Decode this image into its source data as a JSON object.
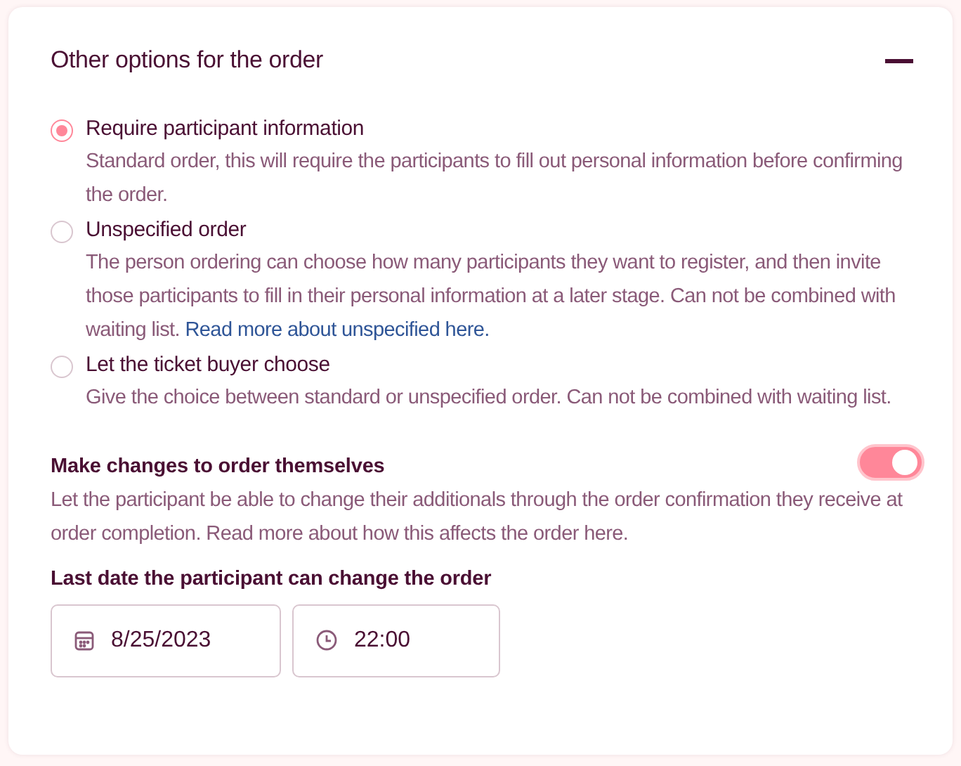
{
  "section": {
    "title": "Other options for the order",
    "expanded": true
  },
  "options": [
    {
      "label": "Require participant information",
      "description": "Standard order, this will require the participants to fill out personal information before confirming the order.",
      "selected": true
    },
    {
      "label": "Unspecified order",
      "description": "The person ordering can choose how many participants they want to register, and then invite those participants to fill in their personal information at a later stage. Can not be combined with waiting list.",
      "link": "Read more about unspecified here.",
      "selected": false
    },
    {
      "label": "Let the ticket buyer choose",
      "description": "Give the choice between standard or unspecified order. Can not be combined with waiting list.",
      "selected": false
    }
  ],
  "self_change": {
    "title": "Make changes to order themselves",
    "on": true,
    "description": "Let the participant be able to change their additionals through the order confirmation they receive at order completion. Read more about how this affects the order here."
  },
  "deadline": {
    "label": "Last date the participant can change the order",
    "date": "8/25/2023",
    "time": "22:00"
  }
}
